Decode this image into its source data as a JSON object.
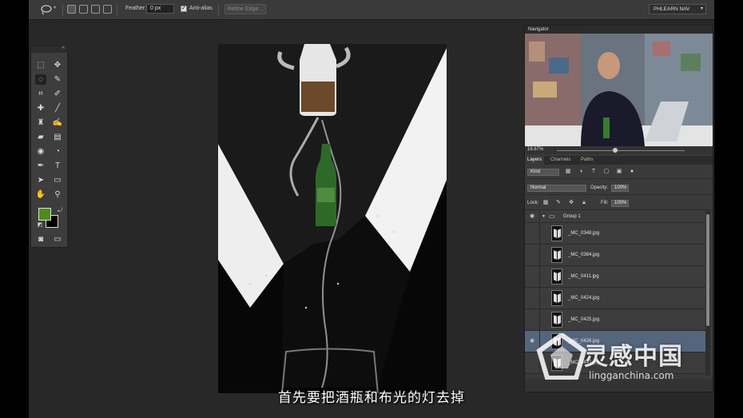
{
  "options_bar": {
    "feather_label": "Feather:",
    "feather_value": "0 px",
    "anti_alias_label": "Anti-alias",
    "anti_alias_checked": true,
    "refine_edge_label": "Refine Edge...",
    "workspace": "PHLEARN NAV"
  },
  "toolbox": {
    "colors": {
      "foreground": "#4e8a1e",
      "background": "#000000"
    }
  },
  "navigator": {
    "title": "Navigator",
    "zoom": "16.67%"
  },
  "layers_panel": {
    "tabs": [
      "Layers",
      "Channels",
      "Paths"
    ],
    "filter_kind": "Kind",
    "blend_mode": "Normal",
    "opacity_label": "Opacity:",
    "opacity_value": "100%",
    "lock_label": "Lock:",
    "fill_label": "Fill:",
    "fill_value": "100%",
    "group_name": "Group 1",
    "layers": [
      {
        "name": "_MC_0348.jpg",
        "visible": false,
        "selected": false
      },
      {
        "name": "_MC_0384.jpg",
        "visible": false,
        "selected": false
      },
      {
        "name": "_MC_0411.jpg",
        "visible": false,
        "selected": false
      },
      {
        "name": "_MC_0424.jpg",
        "visible": false,
        "selected": false
      },
      {
        "name": "_MC_0425.jpg",
        "visible": false,
        "selected": false
      },
      {
        "name": "_MC_0426.jpg",
        "visible": true,
        "selected": true
      },
      {
        "name": "_MC_0447.jpg",
        "visible": false,
        "selected": false
      }
    ]
  },
  "subtitle": "首先要把酒瓶和布光的灯去掉",
  "watermark": {
    "brand": "灵感中国",
    "url": "lingganchina.com"
  }
}
